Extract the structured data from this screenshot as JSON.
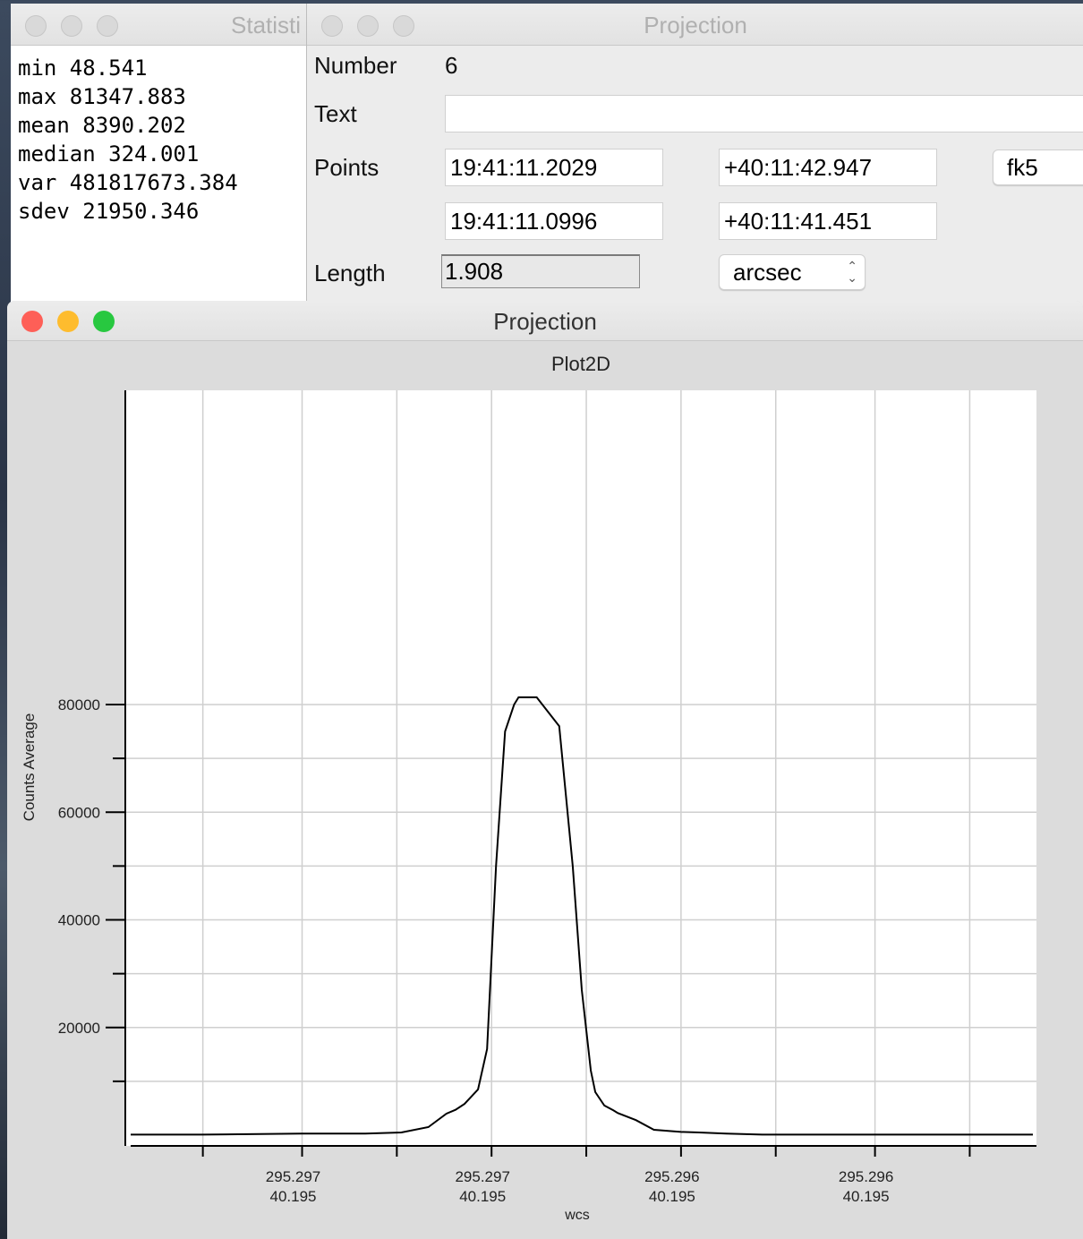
{
  "stats_window": {
    "title": "Statisti",
    "lines": [
      "min 48.541",
      "max 81347.883",
      "mean 8390.202",
      "median 324.001",
      "var 481817673.384",
      "sdev 21950.346"
    ]
  },
  "dialog": {
    "title": "Projection",
    "number_label": "Number",
    "number_value": "6",
    "text_label": "Text",
    "text_value": "",
    "points_label": "Points",
    "p1_ra": "19:41:11.2029",
    "p1_dec": "+40:11:42.947",
    "p2_ra": "19:41:11.0996",
    "p2_dec": "+40:11:41.451",
    "system": "fk5",
    "length_label": "Length",
    "length_value": "1.908",
    "length_unit": "arcsec"
  },
  "plot_window": {
    "title": "Projection"
  },
  "colors": {
    "close": "#fe5f57",
    "minimize": "#febc2e",
    "zoom": "#28c840",
    "inactive": "#d9d9d9"
  },
  "chart_data": {
    "type": "line",
    "title": "Plot2D",
    "xlabel": "wcs",
    "ylabel": "Counts Average",
    "xlim": [
      0,
      1
    ],
    "ylim": [
      0,
      81347.883
    ],
    "grid": true,
    "yticks": [
      {
        "value": 20000,
        "label": "20000"
      },
      {
        "value": 40000,
        "label": "40000"
      },
      {
        "value": 60000,
        "label": "60000"
      },
      {
        "value": 80000,
        "label": "80000"
      }
    ],
    "xticks": [
      {
        "value": 0.19,
        "line1": "295.297",
        "line2": "40.195"
      },
      {
        "value": 0.4,
        "line1": "295.297",
        "line2": "40.195"
      },
      {
        "value": 0.61,
        "line1": "295.296",
        "line2": "40.195"
      },
      {
        "value": 0.825,
        "line1": "295.296",
        "line2": "40.195"
      }
    ],
    "series": [
      {
        "x": [
          0.0,
          0.08,
          0.19,
          0.26,
          0.3,
          0.33,
          0.35,
          0.36,
          0.37,
          0.385,
          0.395,
          0.405,
          0.415,
          0.425,
          0.43,
          0.44,
          0.45,
          0.475,
          0.49,
          0.5,
          0.51,
          0.515,
          0.525,
          0.535,
          0.54,
          0.56,
          0.58,
          0.61,
          0.63,
          0.66,
          0.7,
          0.76,
          0.9,
          1.0
        ],
        "y": [
          100,
          100,
          300,
          300,
          500,
          1500,
          4000,
          4700,
          5800,
          8500,
          16000,
          50000,
          75000,
          80000,
          81347.883,
          81347.883,
          81347.883,
          76000,
          50000,
          27000,
          12000,
          8000,
          5500,
          4600,
          4100,
          2800,
          1000,
          600,
          500,
          300,
          100,
          100,
          100,
          100
        ]
      }
    ]
  }
}
